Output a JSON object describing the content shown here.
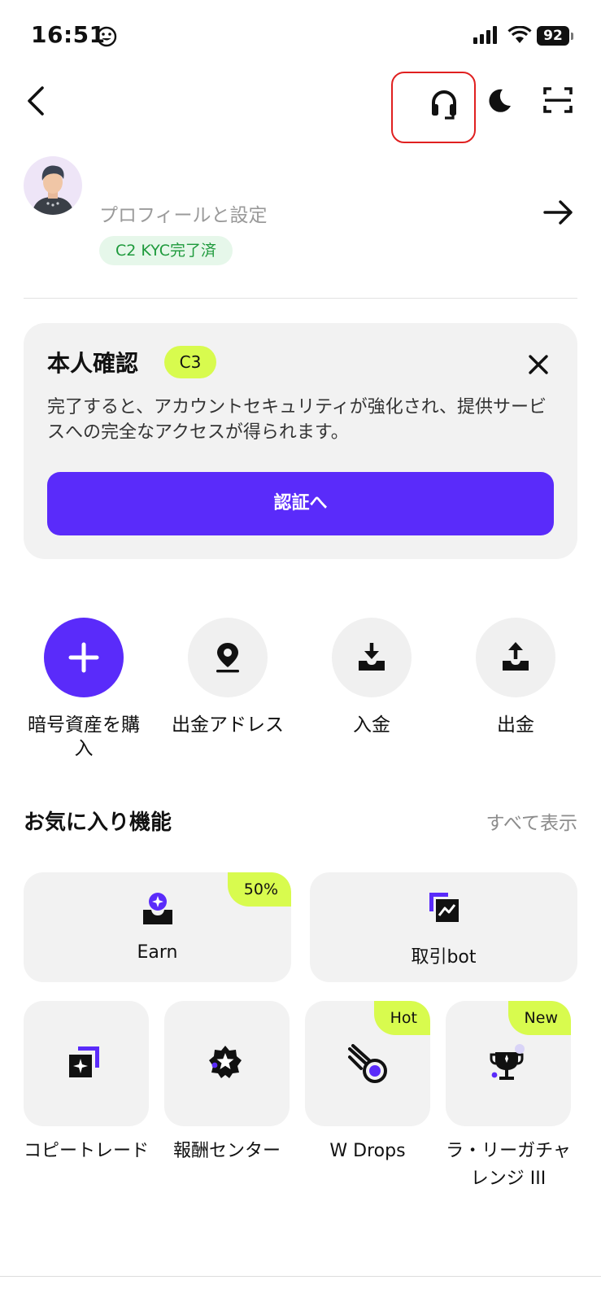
{
  "status_bar": {
    "time": "16:51",
    "battery": "92"
  },
  "nav": {
    "back_icon": "chevron-left-icon",
    "support_icon": "headset-icon",
    "theme_icon": "moon-icon",
    "scan_icon": "scan-icon"
  },
  "profile": {
    "settings_link": "プロフィールと設定",
    "kyc_badge": "C2 KYC完了済"
  },
  "verify_card": {
    "title": "本人確認",
    "level": "C3",
    "description": "完了すると、アカウントセキュリティが強化され、提供サービスへの完全なアクセスが得られます。",
    "button": "認証へ"
  },
  "quick_actions": [
    {
      "label": "暗号資産を購入",
      "icon": "plus-icon"
    },
    {
      "label": "出金アドレス",
      "icon": "location-pin-icon"
    },
    {
      "label": "入金",
      "icon": "deposit-icon"
    },
    {
      "label": "出金",
      "icon": "withdraw-icon"
    }
  ],
  "favorites": {
    "title": "お気に入り機能",
    "view_all": "すべて表示",
    "wide_tiles": [
      {
        "label": "Earn",
        "badge": "50%",
        "icon": "earn-icon"
      },
      {
        "label": "取引bot",
        "badge": "",
        "icon": "trading-bot-icon"
      }
    ],
    "small_tiles": [
      {
        "label": "コピートレード",
        "badge": "",
        "icon": "copy-trade-icon"
      },
      {
        "label": "報酬センター",
        "badge": "",
        "icon": "reward-star-icon"
      },
      {
        "label": "W Drops",
        "badge": "Hot",
        "icon": "drops-comet-icon"
      },
      {
        "label": "ラ・リーガチャレンジ III",
        "badge": "New",
        "icon": "trophy-icon"
      }
    ]
  },
  "colors": {
    "accent": "#5a2bfa",
    "highlight_badge": "#d8fb4e",
    "kyc_green": "#1e9a3c",
    "support_outline": "#e02020"
  }
}
